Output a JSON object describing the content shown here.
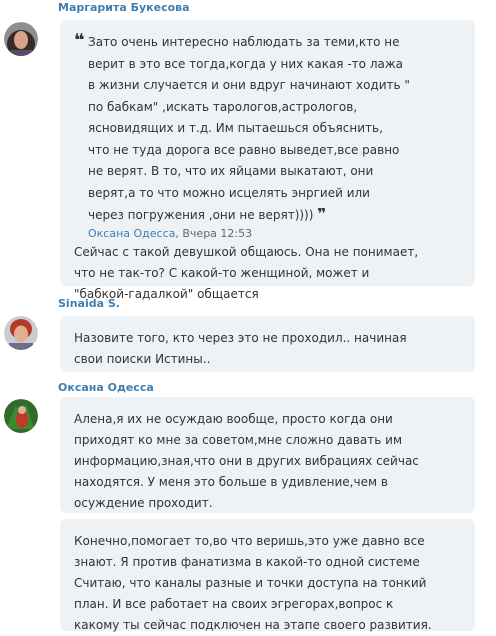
{
  "messages": [
    {
      "author": "Маргарита Букесова",
      "quote": {
        "text": "Зато очень интересно наблюдать за теми,кто не\nверит в это все тогда,когда у них какая -то лажа\nв жизни случается и они вдруг начинают ходить \"\nпо бабкам\" ,искать тарологов,астрологов,\nясновидящих и т.д. Им пытаешься объяснить,\nчто не туда дорога все равно выведет,все равно\nне верят. В то, что их яйцами выкатают, они\nверят,а то что можно исцелять энргией или\nчерез погружения ,они не верят))))",
        "author": "Оксана Одесса",
        "time": ", Вчера 12:53"
      },
      "text": "Сейчас с такой девушкой общаюсь. Она не понимает,\nчто не так-то? С какой-то женщиной, может и\n\"бабкой-гадалкой\" общается"
    },
    {
      "author": "Sinaida S.",
      "text": "Назовите того, кто через это не проходил.. начиная\nсвои поиски Истины.."
    },
    {
      "author": "Оксана Одесса",
      "text": "Алена,я их не осуждаю вообще, просто когда они\nприходят ко мне за советом,мне сложно давать им\nинформацию,зная,что они в других вибрациях сейчас\nнаходятся. У меня это больше в удивление,чем в\nосуждение проходит.",
      "text2": "Конечно,помогает то,во что веришь,это уже давно все\nзнают. Я против фанатизма в какой-то одной системе\nСчитаю, что каналы разные и точки доступа на тонкий\nплан. И все работает на своих эгрегорах,вопрос к\nкакому ты сейчас подключен на этапе своего развития."
    }
  ]
}
